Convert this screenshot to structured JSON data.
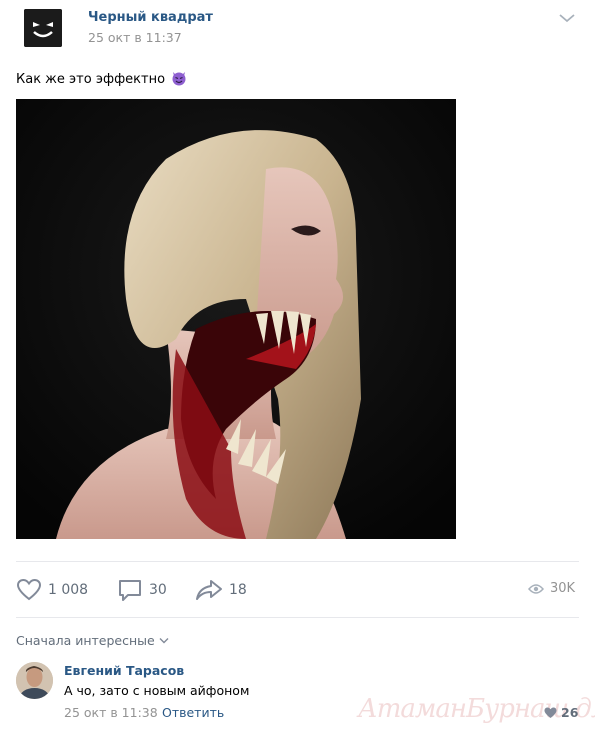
{
  "post": {
    "author": "Черный квадрат",
    "date": "25 окт в 11:37",
    "text": "Как же это эффектно",
    "emoji_icon": "smiling-devil-emoji",
    "likes": "1 008",
    "comments": "30",
    "shares": "18",
    "views": "30K"
  },
  "comments_section": {
    "sort_label": "Сначала интересные",
    "comment": {
      "author": "Евгений Тарасов",
      "text": "А чо, зато с новым айфоном",
      "date": "25 окт в 11:38",
      "reply_label": "Ответить",
      "likes": "26"
    }
  },
  "watermark": "АтаманБурнаш для ЯП",
  "colors": {
    "link": "#2a5885",
    "muted": "#939393",
    "action": "#626d7a",
    "emoji": "#8e5fd0"
  }
}
